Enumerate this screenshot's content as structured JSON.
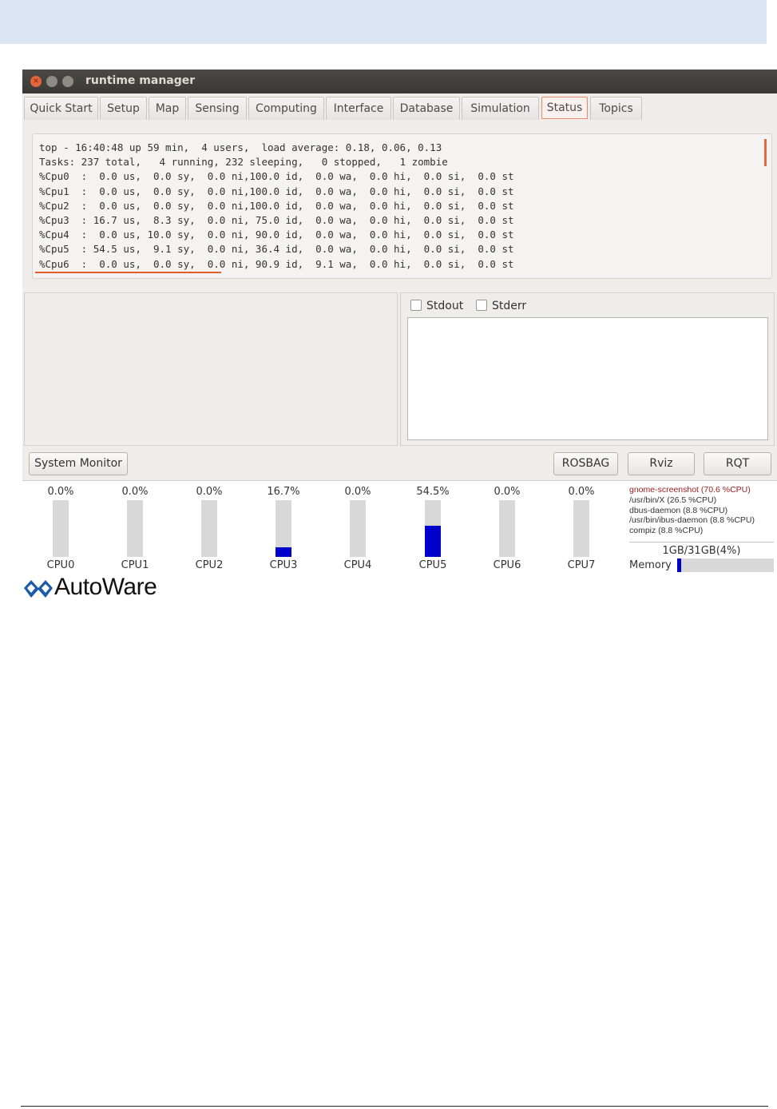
{
  "window": {
    "title": "runtime manager"
  },
  "tabs": [
    "Quick Start",
    "Setup",
    "Map",
    "Sensing",
    "Computing",
    "Interface",
    "Database",
    "Simulation",
    "Status",
    "Topics"
  ],
  "active_tab": "Status",
  "terminal": {
    "lines": [
      "top - 16:40:48 up 59 min,  4 users,  load average: 0.18, 0.06, 0.13",
      "Tasks: 237 total,   4 running, 232 sleeping,   0 stopped,   1 zombie",
      "%Cpu0  :  0.0 us,  0.0 sy,  0.0 ni,100.0 id,  0.0 wa,  0.0 hi,  0.0 si,  0.0 st",
      "%Cpu1  :  0.0 us,  0.0 sy,  0.0 ni,100.0 id,  0.0 wa,  0.0 hi,  0.0 si,  0.0 st",
      "%Cpu2  :  0.0 us,  0.0 sy,  0.0 ni,100.0 id,  0.0 wa,  0.0 hi,  0.0 si,  0.0 st",
      "%Cpu3  : 16.7 us,  8.3 sy,  0.0 ni, 75.0 id,  0.0 wa,  0.0 hi,  0.0 si,  0.0 st",
      "%Cpu4  :  0.0 us, 10.0 sy,  0.0 ni, 90.0 id,  0.0 wa,  0.0 hi,  0.0 si,  0.0 st",
      "%Cpu5  : 54.5 us,  9.1 sy,  0.0 ni, 36.4 id,  0.0 wa,  0.0 hi,  0.0 si,  0.0 st",
      "%Cpu6  :  0.0 us,  0.0 sy,  0.0 ni, 90.9 id,  9.1 wa,  0.0 hi,  0.0 si,  0.0 st"
    ]
  },
  "output": {
    "stdout_label": "Stdout",
    "stderr_label": "Stderr",
    "stdout_checked": false,
    "stderr_checked": false
  },
  "buttons": {
    "system_monitor": "System Monitor",
    "rosbag": "ROSBAG",
    "rviz": "Rviz",
    "rqt": "RQT"
  },
  "cpus": [
    {
      "label": "CPU0",
      "pct_text": "0.0%",
      "value": 0.0
    },
    {
      "label": "CPU1",
      "pct_text": "0.0%",
      "value": 0.0
    },
    {
      "label": "CPU2",
      "pct_text": "0.0%",
      "value": 0.0
    },
    {
      "label": "CPU3",
      "pct_text": "16.7%",
      "value": 16.7
    },
    {
      "label": "CPU4",
      "pct_text": "0.0%",
      "value": 0.0
    },
    {
      "label": "CPU5",
      "pct_text": "54.5%",
      "value": 54.5
    },
    {
      "label": "CPU6",
      "pct_text": "0.0%",
      "value": 0.0
    },
    {
      "label": "CPU7",
      "pct_text": "0.0%",
      "value": 0.0
    }
  ],
  "processes": [
    "gnome-screenshot (70.6 %CPU)",
    "/usr/bin/X (26.5 %CPU)",
    "dbus-daemon (8.8 %CPU)",
    "/usr/bin/ibus-daemon (8.8 %CPU)",
    "compiz (8.8 %CPU)"
  ],
  "memory": {
    "label": "Memory",
    "value_text": "1GB/31GB(4%)",
    "percent": 4
  },
  "logo": {
    "text": "AutoWare"
  },
  "colors": {
    "bar_fill": "#0000cc",
    "active_tab_border": "#e8886b",
    "highlight_underline": "#e45d2a",
    "hot_process": "#9b1c1c"
  }
}
